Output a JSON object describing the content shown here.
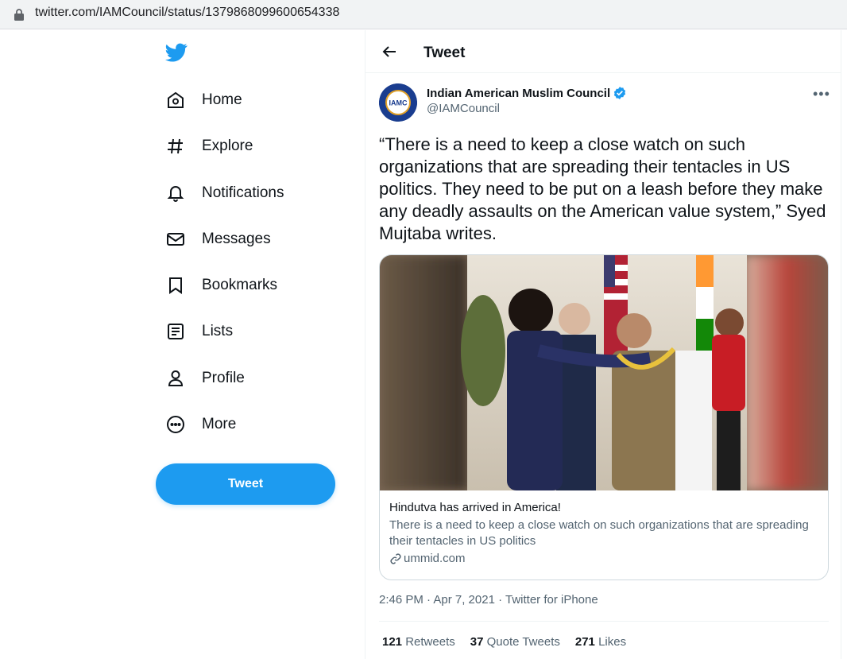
{
  "browser": {
    "url": "twitter.com/IAMCouncil/status/1379868099600654338"
  },
  "sidebar": {
    "items": [
      {
        "label": "Home",
        "icon": "home-icon"
      },
      {
        "label": "Explore",
        "icon": "hashtag-icon"
      },
      {
        "label": "Notifications",
        "icon": "bell-icon"
      },
      {
        "label": "Messages",
        "icon": "envelope-icon"
      },
      {
        "label": "Bookmarks",
        "icon": "bookmark-icon"
      },
      {
        "label": "Lists",
        "icon": "list-icon"
      },
      {
        "label": "Profile",
        "icon": "person-icon"
      },
      {
        "label": "More",
        "icon": "more-circle-icon"
      }
    ],
    "tweet_button": "Tweet"
  },
  "header": {
    "title": "Tweet"
  },
  "tweet": {
    "author": "Indian American Muslim Council",
    "handle": "@IAMCouncil",
    "avatar_text": "IAMC",
    "text": "“There is a need to keep a close watch on such organizations that are spreading their tentacles in US politics. They need to be put on a leash before they make any deadly assaults on the American value system,” Syed Mujtaba writes.",
    "card": {
      "title": "Hindutva has arrived in America!",
      "description": "There is a need to keep a close watch on such organizations that are spreading their tentacles in US politics",
      "domain": "ummid.com"
    },
    "timestamp": "2:46 PM · Apr 7, 2021 · Twitter for iPhone",
    "retweets_count": "121",
    "retweets_label": "Retweets",
    "quotes_count": "37",
    "quotes_label": "Quote Tweets",
    "likes_count": "271",
    "likes_label": "Likes"
  },
  "colors": {
    "accent": "#1d9bf0",
    "text": "#0f1419",
    "secondary": "#536471"
  }
}
